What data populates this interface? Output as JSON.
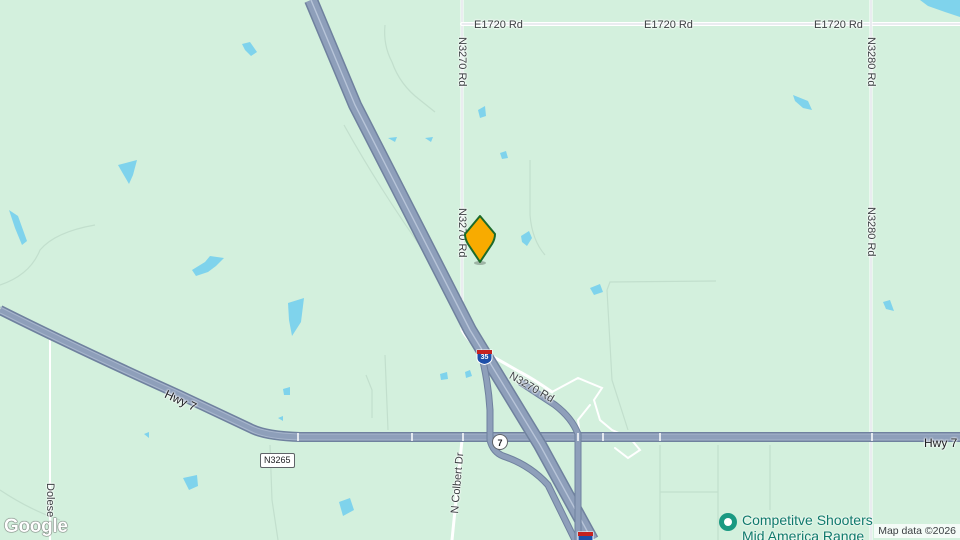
{
  "map": {
    "style": "terrain",
    "colors": {
      "land": "#d3f0dd",
      "water": "#7fd3ec",
      "highway": "#8e9fba",
      "highway_edge": "#6f819e",
      "minor_road": "#ffffff",
      "marker": "#f8ab00",
      "marker_outline": "#1d6b2a"
    },
    "roads": {
      "e1720_a": "E1720 Rd",
      "e1720_b": "E1720 Rd",
      "e1720_c": "E1720 Rd",
      "n3270_top": "N3270 Rd",
      "n3270_mid": "N3270 Rd",
      "n3270_diag": "N3270 Rd",
      "n3280_top": "N3280 Rd",
      "n3280_mid": "N3280 Rd",
      "hwy7_left": "Hwy 7",
      "hwy7_right": "Hwy 7",
      "n_colbert": "N Colbert Dr",
      "dolese": "Dolese"
    },
    "shields": {
      "interstate": "35",
      "state_route": "7",
      "county": "N3265"
    },
    "marker": {
      "icon": "location-pin-icon"
    },
    "poi": {
      "icon": "green-pin-icon",
      "line1": "Competitve Shooters",
      "line2": "Mid America Range"
    }
  },
  "attribution": {
    "logo": "Google",
    "text": "Map data ©2026"
  }
}
